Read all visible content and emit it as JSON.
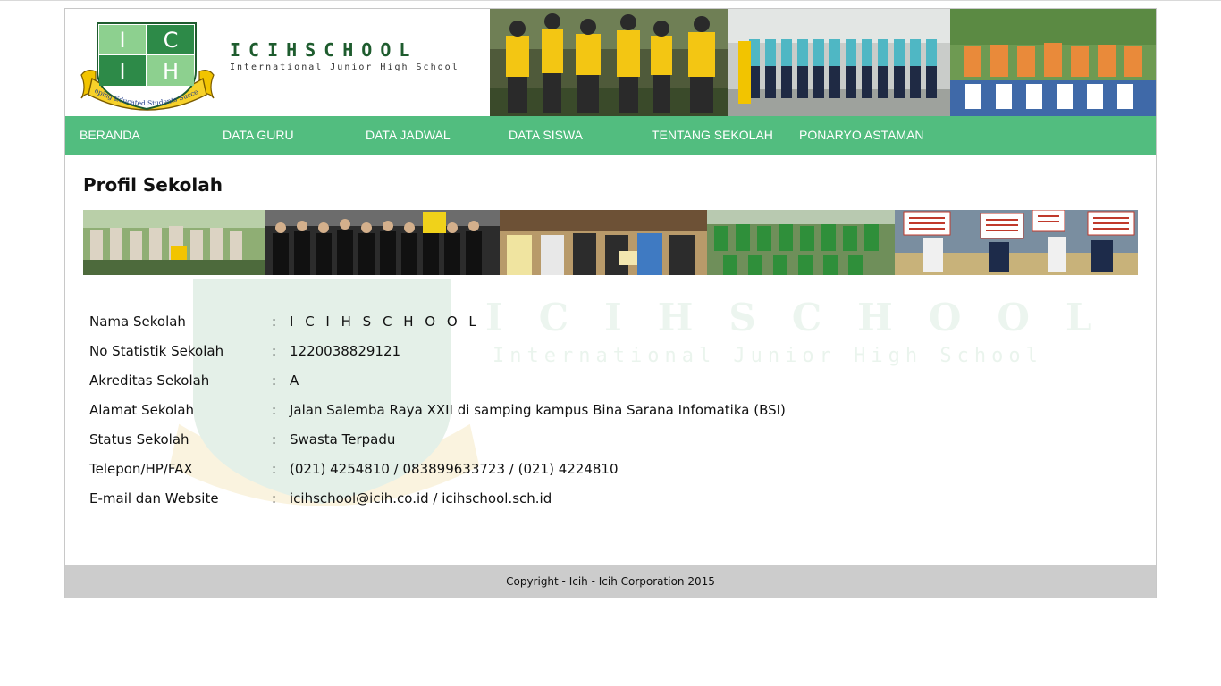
{
  "header": {
    "logo": {
      "letters": [
        "I",
        "C",
        "I",
        "H"
      ],
      "motto": "Developing Educated Students Successfully"
    },
    "brand_title": "ICIHSCHOOL",
    "brand_subtitle": "International Junior High School"
  },
  "nav": {
    "items": [
      "BERANDA",
      "DATA GURU",
      "DATA JADWAL",
      "DATA SISWA",
      "TENTANG SEKOLAH",
      "PONARYO ASTAMAN"
    ]
  },
  "main": {
    "title": "Profil Sekolah",
    "separator": ":",
    "profile": [
      {
        "label": "Nama Sekolah",
        "value": "I C I H S C H O O L"
      },
      {
        "label": "No Statistik Sekolah",
        "value": "1220038829121"
      },
      {
        "label": "Akreditas Sekolah",
        "value": "A"
      },
      {
        "label": "Alamat Sekolah",
        "value": "Jalan Salemba Raya XXII di samping kampus Bina Sarana Infomatika (BSI)"
      },
      {
        "label": "Status Sekolah",
        "value": "Swasta Terpadu"
      },
      {
        "label": "Telepon/HP/FAX",
        "value": "(021) 4254810 / 083899633723 / (021) 4224810"
      },
      {
        "label": "E-mail dan Website",
        "value": "icihschool@icih.co.id / icihschool.sch.id"
      }
    ],
    "watermark": {
      "title": "ICIHSCHOOL",
      "subtitle": "International Junior High School"
    }
  },
  "footer": {
    "copyright": "Copyright - Icih - Icih Corporation 2015"
  },
  "colors": {
    "nav": "#52bd7f",
    "brand_green": "#1e5c2e",
    "footer": "#cccccc",
    "shield_light": "#8dd08f",
    "shield_dark": "#2d8a48",
    "ribbon": "#f2c400"
  }
}
